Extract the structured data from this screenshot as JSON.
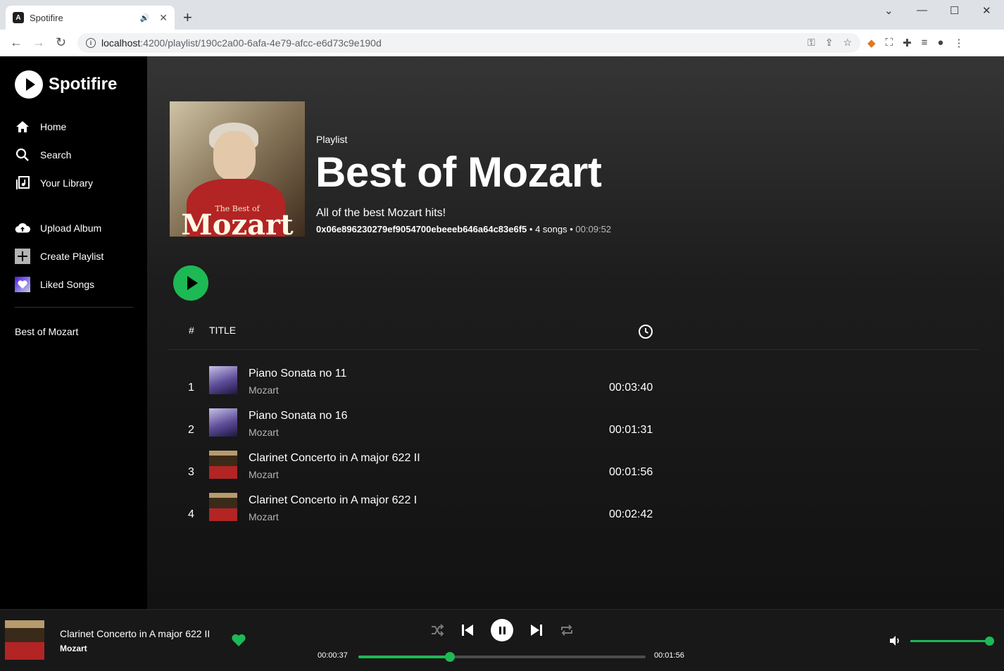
{
  "browser": {
    "tab_title": "Spotifire",
    "tab_favicon": "A",
    "new_tab": "+",
    "url_host": "localhost",
    "url_path": ":4200/playlist/190c2a00-6afa-4e79-afcc-e6d73c9e190d"
  },
  "sidebar": {
    "logo_text": "Spotifire",
    "nav": [
      {
        "label": "Home",
        "icon": "home-icon"
      },
      {
        "label": "Search",
        "icon": "search-icon"
      },
      {
        "label": "Your Library",
        "icon": "library-icon"
      }
    ],
    "actions": [
      {
        "label": "Upload Album",
        "icon": "cloud-upload-icon"
      },
      {
        "label": "Create Playlist",
        "icon": "plus-icon"
      },
      {
        "label": "Liked Songs",
        "icon": "heart-icon"
      }
    ],
    "playlists": [
      "Best of Mozart"
    ]
  },
  "playlist": {
    "type_label": "Playlist",
    "title": "Best of Mozart",
    "description": "All of the best Mozart hits!",
    "owner": "0x06e896230279ef9054700ebeeeb646a64c83e6f5",
    "song_count": "4 songs",
    "duration": "00:09:52",
    "cover_subtitle": "The Best of",
    "cover_title": "Mozart"
  },
  "table": {
    "col_hash": "#",
    "col_title": "TITLE",
    "rows": [
      {
        "num": "1",
        "title": "Piano Sonata no 11",
        "artist": "Mozart",
        "duration": "00:03:40",
        "thumb": "piano"
      },
      {
        "num": "2",
        "title": "Piano Sonata no 16",
        "artist": "Mozart",
        "duration": "00:01:31",
        "thumb": "piano"
      },
      {
        "num": "3",
        "title": "Clarinet Concerto in A major 622 II",
        "artist": "Mozart",
        "duration": "00:01:56",
        "thumb": "mozart"
      },
      {
        "num": "4",
        "title": "Clarinet Concerto in A major 622 I",
        "artist": "Mozart",
        "duration": "00:02:42",
        "thumb": "mozart"
      }
    ]
  },
  "player": {
    "title": "Clarinet Concerto in A major 622 II",
    "artist": "Mozart",
    "current_time": "00:00:37",
    "total_time": "00:01:56",
    "progress": 0.318,
    "volume": 1.0,
    "liked": true
  },
  "colors": {
    "accent": "#1db954",
    "background": "#121212",
    "sidebar": "#000000",
    "player": "#181818"
  }
}
